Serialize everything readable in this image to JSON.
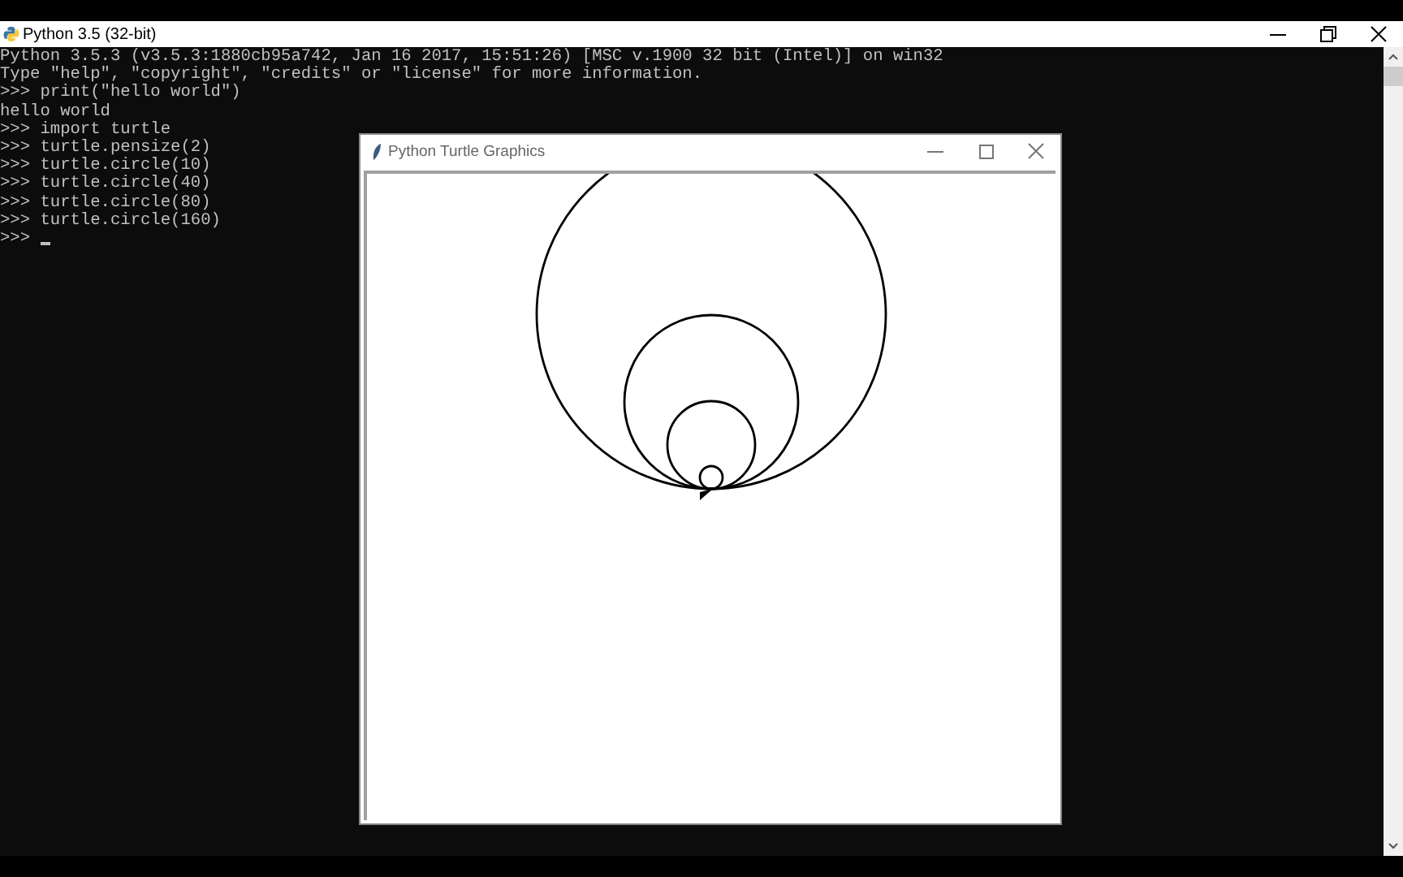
{
  "console": {
    "title": "Python 3.5 (32-bit)",
    "lines": [
      "Python 3.5.3 (v3.5.3:1880cb95a742, Jan 16 2017, 15:51:26) [MSC v.1900 32 bit (Intel)] on win32",
      "Type \"help\", \"copyright\", \"credits\" or \"license\" for more information.",
      ">>> print(\"hello world\")",
      "hello world",
      ">>> import turtle",
      ">>> turtle.pensize(2)",
      ">>> turtle.circle(10)",
      ">>> turtle.circle(40)",
      ">>> turtle.circle(80)",
      ">>> turtle.circle(160)"
    ],
    "prompt": ">>>"
  },
  "turtle_window": {
    "title": "Python Turtle Graphics"
  }
}
